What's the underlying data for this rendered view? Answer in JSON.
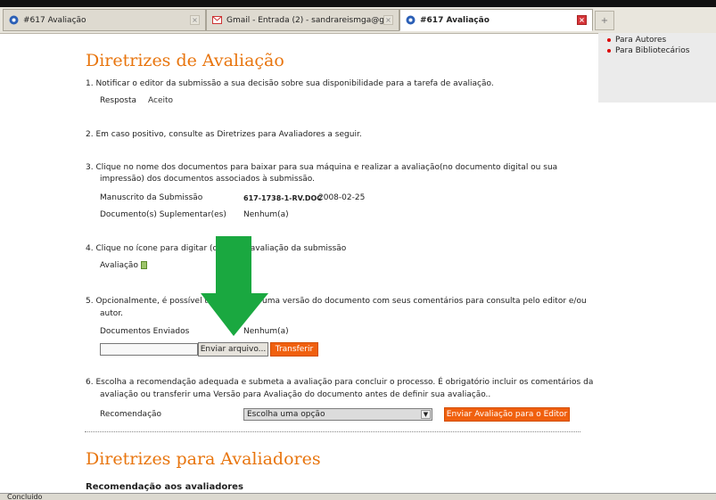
{
  "browser": {
    "tabs": [
      {
        "label": "#617 Avaliação",
        "close": "×"
      },
      {
        "label": "Gmail - Entrada (2) - sandrareismga@g...",
        "close": "×"
      },
      {
        "label": "#617 Avaliação",
        "close": "×"
      }
    ],
    "new_tab": "+",
    "status": "Concluído"
  },
  "sidebar": {
    "links": [
      "Para Autores",
      "Para Bibliotecários"
    ]
  },
  "main": {
    "title": "Diretrizes de Avaliação",
    "steps": {
      "s1": "1. Notificar o editor da submissão a sua decisão sobre sua disponibilidade para a tarefa de avaliação.",
      "s1_resp": "Resposta",
      "s1_aceito": "Aceito",
      "s2": "2. Em caso positivo, consulte as Diretrizes para Avaliadores a seguir.",
      "s3_line1": "3. Clique no nome dos documentos para baixar para sua máquina e realizar a avaliação(no documento digital ou sua",
      "s3_line2": "impressão) dos documentos associados à submissão.",
      "s3_ms_label": "Manuscrito da Submissão",
      "s3_ms_file": "617-1738-1-RV.DOC",
      "s3_ms_date": "2008-02-25",
      "s3_sup_label": "Documento(s) Suplementar(es)",
      "s3_sup_value": "Nenhum(a)",
      "s4_part1": "4. Clique no ícone para digitar (o",
      "s4_part2": ") a avaliação da submissão",
      "s4_aval": "Avaliação",
      "s5_part1": "5. Opcionalmente, é possível tra",
      "s5_part2": "uma versão do documento com seus comentários para consulta pelo editor e/ou",
      "s5_line2": "autor.",
      "s5_docs_label": "Documentos Enviados",
      "s5_docs_value": "Nenhum(a)",
      "s5_browse": "Enviar arquivo...",
      "s5_upload": "Transferir",
      "s6_line1": "6. Escolha a recomendação adequada e submeta a avaliação para concluir o processo. É obrigatório incluir os comentários da",
      "s6_line2": "avaliação ou transferir uma Versão para Avaliação do documento antes de definir sua avaliação..",
      "s6_rec_label": "Recomendação",
      "s6_select": "Escolha uma opção",
      "s6_submit": "Enviar Avaliação para o Editor"
    },
    "title2": "Diretrizes para Avaliadores",
    "subtitle2": "Recomendação aos avaliadores"
  },
  "colors": {
    "accent": "#e8750e",
    "button_orange": "#f0600e",
    "arrow_green": "#1aa840"
  }
}
